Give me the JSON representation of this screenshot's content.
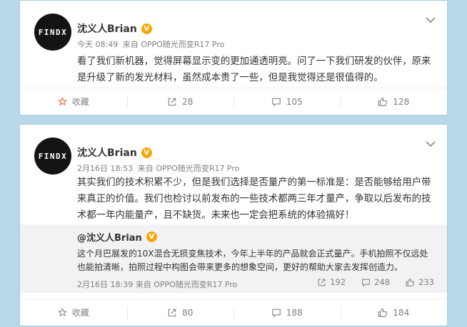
{
  "posts": [
    {
      "avatar_text": "FINDX",
      "author": "沈义人Brian",
      "time": "今天 08:49",
      "source": "来自 OPPO随光而变R17 Pro",
      "text": "看了我们新机器，觉得屏幕显示变的更加通透明亮。问了一下我们研发的伙伴，原来是升级了新的发光材料，虽然成本贵了一些，但是我觉得还是很值得的。",
      "favorite_label": "收藏",
      "repost_count": "28",
      "comment_count": "105",
      "like_count": "128"
    },
    {
      "avatar_text": "FINDX",
      "author": "沈义人Brian",
      "time": "2月16日 18:53",
      "source": "来自 OPPO随光而变R17 Pro",
      "text": "其实我们的技术积累不少，但是我们选择是否量产的第一标准是：是否能够给用户带来真正的价值。我们也检讨以前发布的一些技术都两三年才量产，争取以后发布的技术都一年内能量产，且不缺货。未来也一定会把系统的体验搞好！",
      "quoted": {
        "author": "@沈义人Brian",
        "text": "这个月巴展发的10X混合无损变焦技术，今年上半年的产品就会正式量产。手机拍照不仅远处也能拍清晰，拍照过程中构图会带来更多的想象空间，更好的帮助大家去发挥创造力。",
        "time": "2月16日 18:39",
        "source": "来自 OPPO随光而变R17 Pro",
        "repost_count": "192",
        "comment_count": "248",
        "like_count": "233"
      },
      "favorite_label": "收藏",
      "repost_count": "80",
      "comment_count": "188",
      "like_count": "184"
    }
  ],
  "colors": {
    "page_bg": "#b8d8ea",
    "verified_badge": "#f4a70c",
    "favorite_star": "#e8683c",
    "muted_text": "#808080"
  },
  "icons": {
    "more": "chevron-down-icon",
    "favorite": "star-icon",
    "repost": "repost-icon",
    "comment": "comment-icon",
    "like": "thumbs-up-icon",
    "verified": "verified-v-icon"
  }
}
